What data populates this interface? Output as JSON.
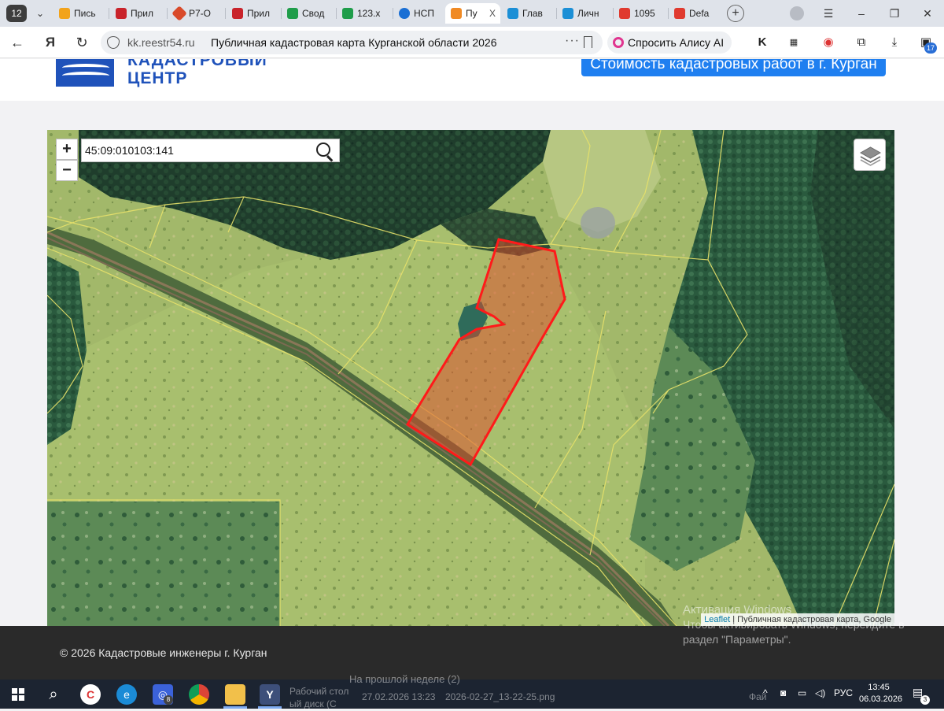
{
  "browser": {
    "tab_count": "12",
    "tabs": [
      {
        "label": "Пись",
        "color": "#f2a31b"
      },
      {
        "label": "Прил",
        "color": "#c9232b"
      },
      {
        "label": "Р7-О",
        "color": "#d94a2a"
      },
      {
        "label": "Прил",
        "color": "#c9232b"
      },
      {
        "label": "Свод",
        "color": "#1f9d4a"
      },
      {
        "label": "123.x",
        "color": "#1f9d4a"
      },
      {
        "label": "НСП",
        "color": "#1a6fd4"
      },
      {
        "label": "Пу",
        "color": "#f08a24"
      },
      {
        "label": "Глав",
        "color": "#1b8fd6"
      },
      {
        "label": "Личн",
        "color": "#1b8fd6"
      },
      {
        "label": "1095",
        "color": "#e03a2f"
      },
      {
        "label": "Defa",
        "color": "#e03a2f"
      }
    ],
    "close_glyph": "X",
    "new_tab_glyph": "+",
    "window_controls": {
      "menu": "☰",
      "minimize": "–",
      "restore": "❐",
      "close": "✕"
    },
    "nav": {
      "back": "←",
      "yandex": "Я",
      "reload": "↻"
    },
    "address": {
      "domain": "kk.reestr54.ru",
      "page_title": "Публичная кадастровая карта Курганской области 2026",
      "more": "···"
    },
    "alice_label": "Спросить Алису AI",
    "extension_badge": "17"
  },
  "site": {
    "logo_line1": "КАДАСТРОВЫЙ",
    "logo_line2": "ЦЕНТР",
    "cost_button": "Стоимость кадастровых работ в г. Курган"
  },
  "map": {
    "zoom_in": "+",
    "zoom_out": "−",
    "search_value": "45:09:010103:141",
    "attribution_leaflet": "Leaflet",
    "attribution_rest": " | Публичная кадастровая карта, Google",
    "parcel_color": "#ff1a1a"
  },
  "footer": {
    "copyright": "© 2026 Кадастровые инженеры г. Курган",
    "activation_line1": "Активация Windows",
    "activation_line2": "Чтобы активировать Windows, перейдите в",
    "activation_line3": "раздел \"Параметры\"."
  },
  "taskbar": {
    "chrome_badge": "8",
    "desktop_label": "Рабочий стол",
    "ghost_heading": "На прошлой неделе (2)",
    "ghost_date": "27.02.2026 13:23",
    "ghost_file": "2026-02-27_13-22-25.png",
    "ghost_left": "ый диск (С",
    "ghost_right": "Фай",
    "tray_chevron": "^",
    "lang": "РУС",
    "time": "13:45",
    "date": "06.03.2026",
    "notif_count": "3"
  }
}
